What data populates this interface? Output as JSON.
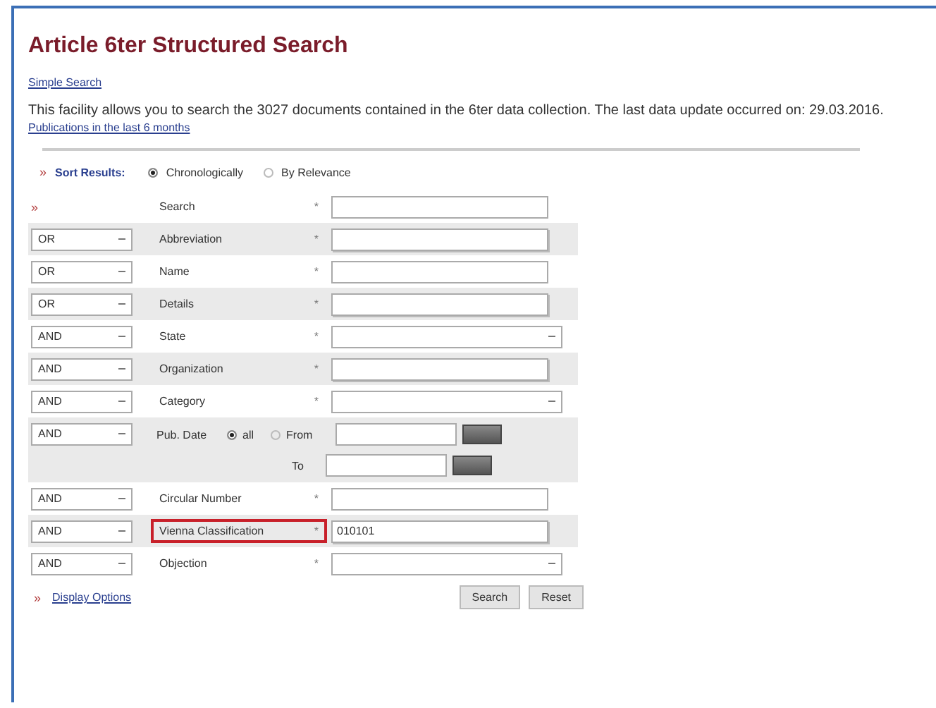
{
  "title": "Article 6ter Structured Search",
  "simple_search_link": "Simple Search",
  "description": "This facility allows you to search the 3027 documents contained in the 6ter data collection. The last data update occurred on: 29.03.2016.",
  "recent_link": "Publications in the last 6 months",
  "sort": {
    "marker": "»",
    "label": "Sort Results:",
    "options": [
      {
        "label": "Chronologically",
        "selected": true
      },
      {
        "label": "By Relevance",
        "selected": false
      }
    ]
  },
  "rows": [
    {
      "kind": "text",
      "marker": "»",
      "label": "Search",
      "asterisk": "*",
      "highlighted": false
    },
    {
      "kind": "text",
      "operator": "OR",
      "label": "Abbreviation",
      "asterisk": "*",
      "highlighted": false
    },
    {
      "kind": "text",
      "operator": "OR",
      "label": "Name",
      "asterisk": "*",
      "highlighted": false
    },
    {
      "kind": "text",
      "operator": "OR",
      "label": "Details",
      "asterisk": "*",
      "highlighted": false
    },
    {
      "kind": "select",
      "operator": "AND",
      "label": "State",
      "asterisk": "*",
      "highlighted": false
    },
    {
      "kind": "text",
      "operator": "AND",
      "label": "Organization",
      "asterisk": "*",
      "highlighted": false
    },
    {
      "kind": "select",
      "operator": "AND",
      "label": "Category",
      "asterisk": "*",
      "highlighted": false
    },
    {
      "kind": "date",
      "operator": "AND",
      "label": "Pub. Date",
      "options": [
        {
          "label": "all",
          "selected": true
        },
        {
          "label": "From",
          "selected": false
        }
      ],
      "to_label": "To"
    },
    {
      "kind": "text",
      "operator": "AND",
      "label": "Circular Number",
      "asterisk": "*",
      "highlighted": false
    },
    {
      "kind": "text",
      "operator": "AND",
      "label": "Vienna Classification",
      "asterisk": "*",
      "value": "010101",
      "highlighted": true
    },
    {
      "kind": "select",
      "operator": "AND",
      "label": "Objection",
      "asterisk": "*",
      "highlighted": false
    }
  ],
  "display_options": {
    "marker": "»",
    "label": "Display Options"
  },
  "buttons": [
    "Search",
    "Reset"
  ]
}
